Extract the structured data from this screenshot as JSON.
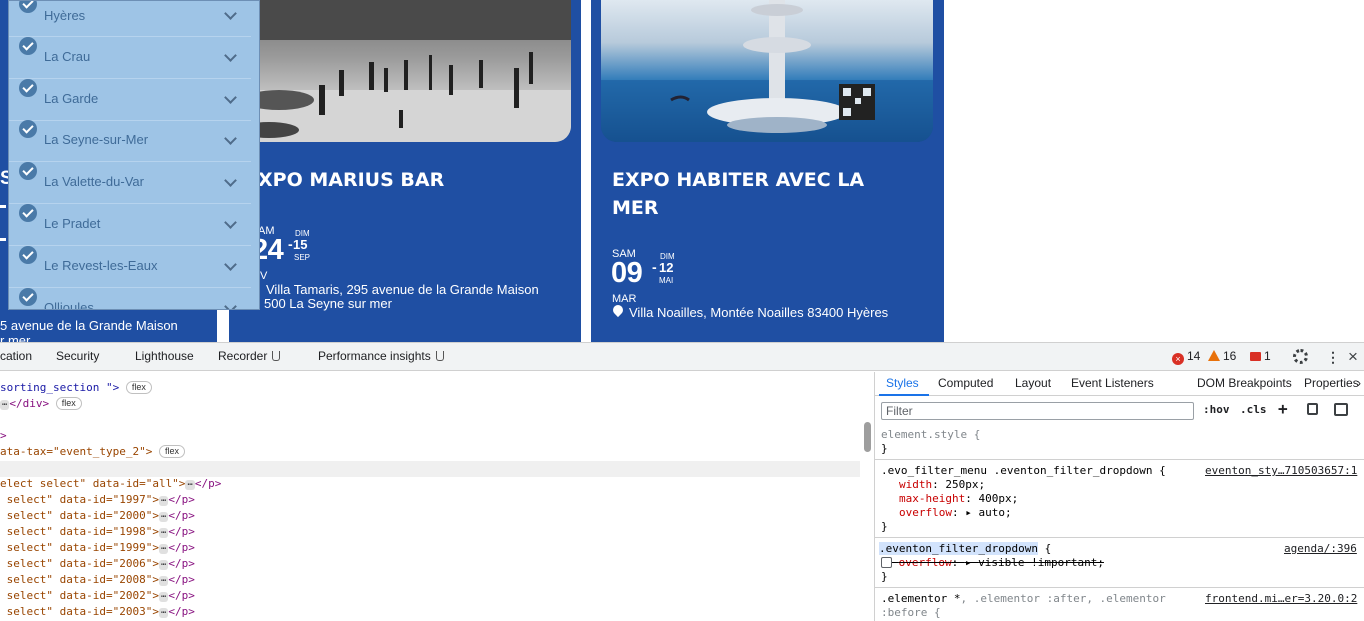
{
  "webpage": {
    "cards": [
      {
        "title_line1": "",
        "address_line1": "5 avenue de la Grande Maison",
        "address_line2": "r mer"
      },
      {
        "title_line1": "XPO MARIUS BAR",
        "start_dow": "AM",
        "start_day": "24",
        "end_dow": "DIM",
        "end_day": "15",
        "end_month": "SEP",
        "start_month": "V",
        "location_line1": "Villa Tamaris, 295 avenue de la Grande Maison",
        "location_line2": "500 La Seyne sur mer"
      },
      {
        "title_line1": "EXPO HABITER AVEC LA",
        "title_line2": "MER",
        "start_dow": "SAM",
        "start_day": "09",
        "end_dow": "DIM",
        "end_day": "12",
        "end_month": "MAI",
        "start_month": "MAR",
        "location": "Villa Noailles, Montée Noailles 83400 Hyères"
      }
    ],
    "dropdown": {
      "items": [
        "Hyères",
        "La Crau",
        "La Garde",
        "La Seyne-sur-Mer",
        "La Valette-du-Var",
        "Le Pradet",
        "Le Revest-les-Eaux",
        "Ollioules"
      ]
    }
  },
  "devtools": {
    "tabs": [
      "cation",
      "Security",
      "Lighthouse",
      "Recorder",
      "Performance insights"
    ],
    "errors": "14",
    "warnings": "16",
    "messages": "1",
    "elements_lines": [
      {
        "pre": "sorting_section \">",
        "badge": "flex"
      },
      {
        "pre": "",
        "mid": "</div>",
        "badge": "flex"
      },
      {
        "pre": ">"
      },
      {
        "pre": "ata-tax=\"event_type_2\">",
        "badge": "flex"
      },
      {
        "pre": "elect select\" data-id=\"all\">",
        "post": "</p>"
      },
      {
        "pre": " select\" data-id=\"1997\">",
        "post": "</p>"
      },
      {
        "pre": " select\" data-id=\"2000\">",
        "post": "</p>"
      },
      {
        "pre": " select\" data-id=\"1998\">",
        "post": "</p>"
      },
      {
        "pre": " select\" data-id=\"1999\">",
        "post": "</p>"
      },
      {
        "pre": " select\" data-id=\"2006\">",
        "post": "</p>"
      },
      {
        "pre": " select\" data-id=\"2008\">",
        "post": "</p>"
      },
      {
        "pre": " select\" data-id=\"2002\">",
        "post": "</p>"
      },
      {
        "pre": " select\" data-id=\"2003\">",
        "post": "</p>"
      }
    ],
    "styles": {
      "tabs": [
        "Styles",
        "Computed",
        "Layout",
        "Event Listeners",
        "DOM Breakpoints",
        "Properties"
      ],
      "filter_placeholder": "Filter",
      "hov": ":hov",
      "cls": ".cls",
      "element_style": "element.style {",
      "close_brace": "}",
      "rule1_selector": ".evo_filter_menu .eventon_filter_dropdown {",
      "rule1_source": "eventon_sty…710503657:1",
      "rule1_props": [
        {
          "name": "width",
          "value": "250px;"
        },
        {
          "name": "max-height",
          "value": "400px;"
        },
        {
          "name": "overflow",
          "value": "auto;"
        }
      ],
      "rule2_selector": ".eventon_filter_dropdown",
      "rule2_source": "agenda/:396",
      "rule2_prop": "overflow",
      "rule2_value": "visible !important;",
      "rule3_selector_a": ".elementor *",
      "rule3_selector_b": ", .elementor :after, .elementor",
      "rule3_selector_c": ":before {",
      "rule3_source": "frontend.mi…er=3.20.0:2"
    }
  }
}
